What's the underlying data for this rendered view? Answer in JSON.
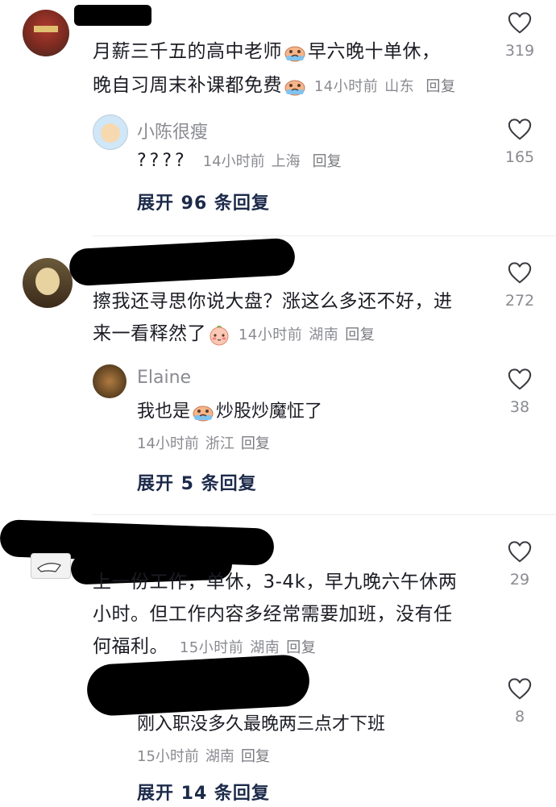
{
  "comments": [
    {
      "name": "",
      "text_line1": "月薪三千五的高中老师",
      "text_line1b": "早六晚十单休，",
      "text_line2": "晚自习周末补课都免费",
      "time": "14小时前",
      "location": "山东",
      "reply_label": "回复",
      "likes": "319",
      "replies": [
        {
          "name": "小陈很瘦",
          "text": "????",
          "time": "14小时前",
          "location": "上海",
          "reply_label": "回复",
          "likes": "165"
        }
      ],
      "expand_label": "展开 96 条回复"
    },
    {
      "name": "",
      "text_line1": "擦我还寻思你说大盘？涨这么多还不好，进",
      "text_line2": "来一看释然了",
      "time": "14小时前",
      "location": "湖南",
      "reply_label": "回复",
      "likes": "272",
      "replies": [
        {
          "name": "Elaine",
          "text_a": "我也是",
          "text_b": "炒股炒魔怔了",
          "time": "14小时前",
          "location": "浙江",
          "reply_label": "回复",
          "likes": "38"
        }
      ],
      "expand_label": "展开 5 条回复"
    },
    {
      "name": "",
      "text_line1": "上一份工作，单休，3-4k，早九晚六午休两",
      "text_line2": "小时。但工作内容多经常需要加班，没有任",
      "text_line3": "何福利。",
      "time": "15小时前",
      "location": "湖南",
      "reply_label": "回复",
      "likes": "29",
      "replies": [
        {
          "name": "",
          "text": "刚入职没多久最晚两三点才下班",
          "time": "15小时前",
          "location": "湖南",
          "reply_label": "回复",
          "likes": "8"
        }
      ],
      "expand_label": "展开 14 条回复"
    }
  ],
  "icons": {
    "like": "heart-outline-icon",
    "emoji_cry": "crying-emoji-icon",
    "emoji_shy": "shy-emoji-icon"
  },
  "colors": {
    "meta": "#8a8b91",
    "expand": "#1c2a4a",
    "text": "#1c1d24",
    "redaction": "#000000"
  }
}
